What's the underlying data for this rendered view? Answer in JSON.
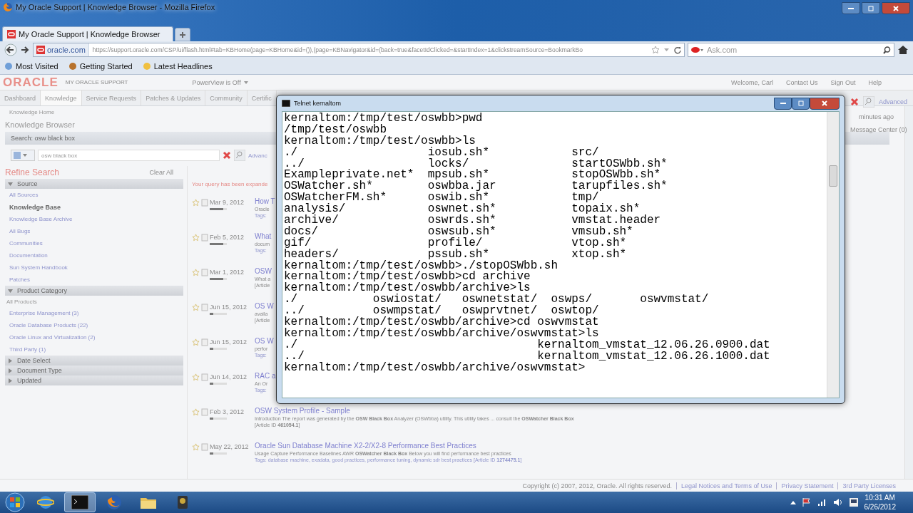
{
  "browser": {
    "title": "My Oracle Support | Knowledge Browser - Mozilla Firefox",
    "tabs": [
      {
        "label": "My Oracle Support | Knowledge Browser",
        "selected": true
      }
    ],
    "identity": "oracle.com",
    "url": "https://support.oracle.com/CSP/ui/flash.html#tab=KBHome(page=KBHome&id=()),(page=KBNavigator&id=(back=true&facetIdClicked=&startIndex=1&clickstreamSource=BookmarkBo",
    "search": {
      "placeholder": "Ask.com"
    },
    "bookmarks": [
      "Most Visited",
      "Getting Started",
      "Latest Headlines"
    ]
  },
  "page": {
    "logo": "ORACLE",
    "product": "MY ORACLE SUPPORT",
    "powerview": "PowerView is Off",
    "user_links": [
      "Welcome, Carl",
      "Contact Us",
      "Sign Out",
      "Help"
    ],
    "nav": [
      {
        "label": "Dashboard",
        "selected": false
      },
      {
        "label": "Knowledge",
        "selected": true
      },
      {
        "label": "Service Requests",
        "selected": false
      },
      {
        "label": "Patches & Updates",
        "selected": false
      },
      {
        "label": "Community",
        "selected": false
      },
      {
        "label": "Certific",
        "selected": false
      }
    ],
    "breadcrumb": "Knowledge Home",
    "heading": "Knowledge Browser",
    "search_title": "Search: osw black box",
    "query": "osw black box",
    "advanced": "Advanc",
    "right_panel": {
      "advanced": "Advanced",
      "updated": "minutes ago",
      "message_center": "Message Center (0)"
    },
    "refine": {
      "title": "Refine Search",
      "clear": "Clear All",
      "sections": [
        {
          "title": "Source",
          "expanded": true,
          "items": [
            {
              "label": "All Sources",
              "selected": false
            },
            {
              "label": "Knowledge Base",
              "selected": true
            },
            {
              "label": "Knowledge Base Archive",
              "selected": false
            },
            {
              "label": "All Bugs",
              "selected": false
            },
            {
              "label": "Communities",
              "selected": false
            },
            {
              "label": "Documentation",
              "selected": false
            },
            {
              "label": "Sun System Handbook",
              "selected": false
            },
            {
              "label": "Patches",
              "selected": false
            }
          ]
        },
        {
          "title": "Product Category",
          "expanded": true,
          "all_label": "All Products",
          "items": [
            {
              "label": "Enterprise Management (3)",
              "selected": false
            },
            {
              "label": "Oracle Database Products (22)",
              "selected": false
            },
            {
              "label": "Oracle Linux and Virtualization (2)",
              "selected": false
            },
            {
              "label": "Third Party (1)",
              "selected": false
            }
          ]
        },
        {
          "title": "Date Select",
          "expanded": false
        },
        {
          "title": "Document Type",
          "expanded": false
        },
        {
          "title": "Updated",
          "expanded": false
        }
      ]
    },
    "notice": "Your query has been expande",
    "results": [
      {
        "date": "Mar 9, 2012",
        "level": 0.8,
        "title": "How T",
        "lines": [
          {
            "kind": "desc",
            "text": "Oracle"
          },
          {
            "kind": "tags",
            "text": "Tags:"
          }
        ]
      },
      {
        "date": "Feb 5, 2012",
        "level": 0.8,
        "title": "What",
        "lines": [
          {
            "kind": "desc",
            "text": "docum"
          },
          {
            "kind": "tags",
            "text": "Tags:"
          }
        ]
      },
      {
        "date": "Mar 1, 2012",
        "level": 0.8,
        "title": "OSW",
        "lines": [
          {
            "kind": "desc",
            "text": "What a"
          },
          {
            "kind": "desc",
            "text": "[Article"
          }
        ]
      },
      {
        "date": "Jun 15, 2012",
        "level": 0.2,
        "title": "OS W",
        "lines": [
          {
            "kind": "desc",
            "text": "availa"
          },
          {
            "kind": "desc",
            "text": "[Article"
          }
        ]
      },
      {
        "date": "Jun 15, 2012",
        "level": 0.2,
        "title": "OS W",
        "lines": [
          {
            "kind": "desc",
            "text": "perfor"
          },
          {
            "kind": "tags",
            "text": "Tags:"
          }
        ]
      },
      {
        "date": "Jun 14, 2012",
        "level": 0.2,
        "title": "RAC a",
        "lines": [
          {
            "kind": "desc",
            "text": "An Or"
          },
          {
            "kind": "tags",
            "text": "Tags:"
          }
        ]
      },
      {
        "date": "Feb 3, 2012",
        "level": 0.2,
        "title": "OSW System Profile - Sample",
        "lines": [
          {
            "kind": "desc",
            "text": "Introduction The report was generated by the **OSW Black Box** Analyzer (OSWbba) utility. This utility takes ... consult the **OSWatcher Black Box**"
          },
          {
            "kind": "desc",
            "text": "[Article ID **461054.1**]"
          }
        ]
      },
      {
        "date": "May 22, 2012",
        "level": 0.2,
        "title": "Oracle Sun Database Machine X2-2/X2-8 Performance Best Practices",
        "lines": [
          {
            "kind": "desc",
            "text": "Usage Capture Performance Baselines AWR **OSWatcher Black Box** Below you will find performance best practices"
          },
          {
            "kind": "tags",
            "text": "Tags: database machine, exadata, good practices, performance tuning, dynamic sdr best practices  [Article ID **1274475.1**]"
          }
        ]
      }
    ],
    "footer": {
      "copyright": "Copyright (c) 2007, 2012, Oracle. All rights reserved.",
      "links": [
        "Legal Notices and Terms of Use",
        "Privacy Statement",
        "3rd Party Licenses"
      ]
    }
  },
  "telnet": {
    "title": "Telnet kernaltom",
    "lines": [
      "kernaltom:/tmp/test/oswbb>pwd",
      "/tmp/test/oswbb",
      "kernaltom:/tmp/test/oswbb>ls",
      "./                   iosub.sh*            src/",
      "../                  locks/               startOSWbb.sh*",
      "Exampleprivate.net*  mpsub.sh*            stopOSWbb.sh*",
      "OSWatcher.sh*        oswbba.jar           tarupfiles.sh*",
      "OSWatcherFM.sh*      oswib.sh*            tmp/",
      "analysis/            oswnet.sh*           topaix.sh*",
      "archive/             oswrds.sh*           vmstat.header",
      "docs/                oswsub.sh*           vmsub.sh*",
      "gif/                 profile/             vtop.sh*",
      "headers/             pssub.sh*            xtop.sh*",
      "kernaltom:/tmp/test/oswbb>./stopOSWbb.sh",
      "kernaltom:/tmp/test/oswbb>cd archive",
      "kernaltom:/tmp/test/oswbb/archive>ls",
      "./           oswiostat/   oswnetstat/  oswps/       oswvmstat/",
      "../          oswmpstat/   oswprvtnet/  oswtop/",
      "kernaltom:/tmp/test/oswbb/archive>cd oswvmstat",
      "kernaltom:/tmp/test/oswbb/archive/oswvmstat>ls",
      "./                                   kernaltom_vmstat_12.06.26.0900.dat",
      "../                                  kernaltom_vmstat_12.06.26.1000.dat",
      "kernaltom:/tmp/test/oswbb/archive/oswvmstat>"
    ]
  },
  "taskbar": {
    "apps": [
      {
        "kind": "ie",
        "active": false
      },
      {
        "kind": "terminal",
        "active": true
      },
      {
        "kind": "firefox",
        "active": false
      },
      {
        "kind": "folder",
        "active": false
      },
      {
        "kind": "camera",
        "active": false
      }
    ],
    "time": "10:31 AM",
    "date": "6/26/2012"
  }
}
